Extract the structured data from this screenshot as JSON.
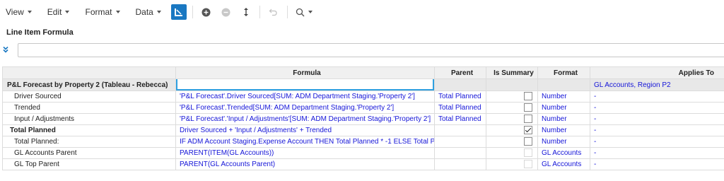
{
  "menu": {
    "view": "View",
    "edit": "Edit",
    "format": "Format",
    "data": "Data"
  },
  "toolbar_icons": [
    "formula-icon",
    "add-icon",
    "remove-icon",
    "move-icon",
    "undo-icon",
    "search-icon"
  ],
  "colors": {
    "accent": "#1a78c2",
    "link": "#1515d8",
    "editor_border": "#2fa0e0"
  },
  "section_title": "Line Item Formula",
  "grid": {
    "headers": {
      "formula": "Formula",
      "parent": "Parent",
      "is_summary": "Is Summary",
      "format": "Format",
      "applies_to": "Applies To"
    },
    "group": {
      "name": "P&L Forecast by Property 2 (Tableau - Rebecca)",
      "applies_to": "GL Accounts, Region P2"
    },
    "rows": [
      {
        "name": "Driver Sourced",
        "formula": "'P&L Forecast'.Driver Sourced[SUM: ADM Department Staging.'Property 2']",
        "parent": "Total Planned",
        "summary": "unchecked",
        "format": "Number",
        "applies_to": "-"
      },
      {
        "name": "Trended",
        "formula": "'P&L Forecast'.Trended[SUM: ADM Department Staging.'Property 2']",
        "parent": "Total Planned",
        "summary": "unchecked",
        "format": "Number",
        "applies_to": "-"
      },
      {
        "name": "Input / Adjustments",
        "formula": "'P&L Forecast'.'Input / Adjustments'[SUM: ADM Department Staging.'Property 2']",
        "parent": "Total Planned",
        "summary": "unchecked",
        "format": "Number",
        "applies_to": "-"
      },
      {
        "name": "Total Planned",
        "formula": "Driver Sourced + 'Input / Adjustments' + Trended",
        "parent": "",
        "summary": "checked",
        "format": "Number",
        "applies_to": "-"
      },
      {
        "name": "Total Planned:",
        "formula": "IF ADM Account Staging.Expense Account THEN Total Planned * -1 ELSE Total P",
        "parent": "",
        "summary": "unchecked",
        "format": "Number",
        "applies_to": "-"
      },
      {
        "name": "GL Accounts Parent",
        "formula": "PARENT(ITEM(GL Accounts))",
        "parent": "",
        "summary": "disabled",
        "format": "GL Accounts",
        "applies_to": "-"
      },
      {
        "name": "GL Top Parent",
        "formula": "PARENT(GL Accounts Parent)",
        "parent": "",
        "summary": "disabled",
        "format": "GL Accounts",
        "applies_to": "-"
      }
    ]
  }
}
